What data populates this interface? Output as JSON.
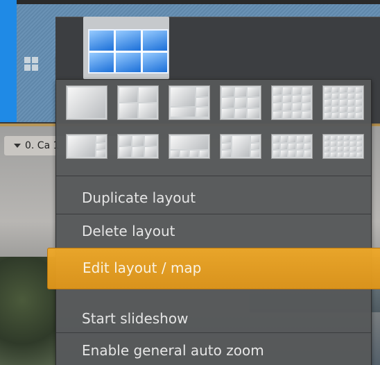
{
  "camera_label": "0. Ca     1",
  "menu": {
    "items": [
      {
        "label": "Duplicate layout"
      },
      {
        "label": "Delete layout"
      },
      {
        "label": "Edit layout / map"
      },
      {
        "label": "Start slideshow"
      },
      {
        "label": "Enable general auto zoom"
      }
    ],
    "highlight_color": "#f0a81f"
  },
  "icons": {
    "layout_grid": "grid-icon",
    "menu_toggle": "layout-menu-icon",
    "camera_dropdown": "chevron-down-icon"
  },
  "colors": {
    "accent": "#1f8ae6",
    "menu_bg": "#56585a",
    "menu_button": "#f2a21a"
  }
}
